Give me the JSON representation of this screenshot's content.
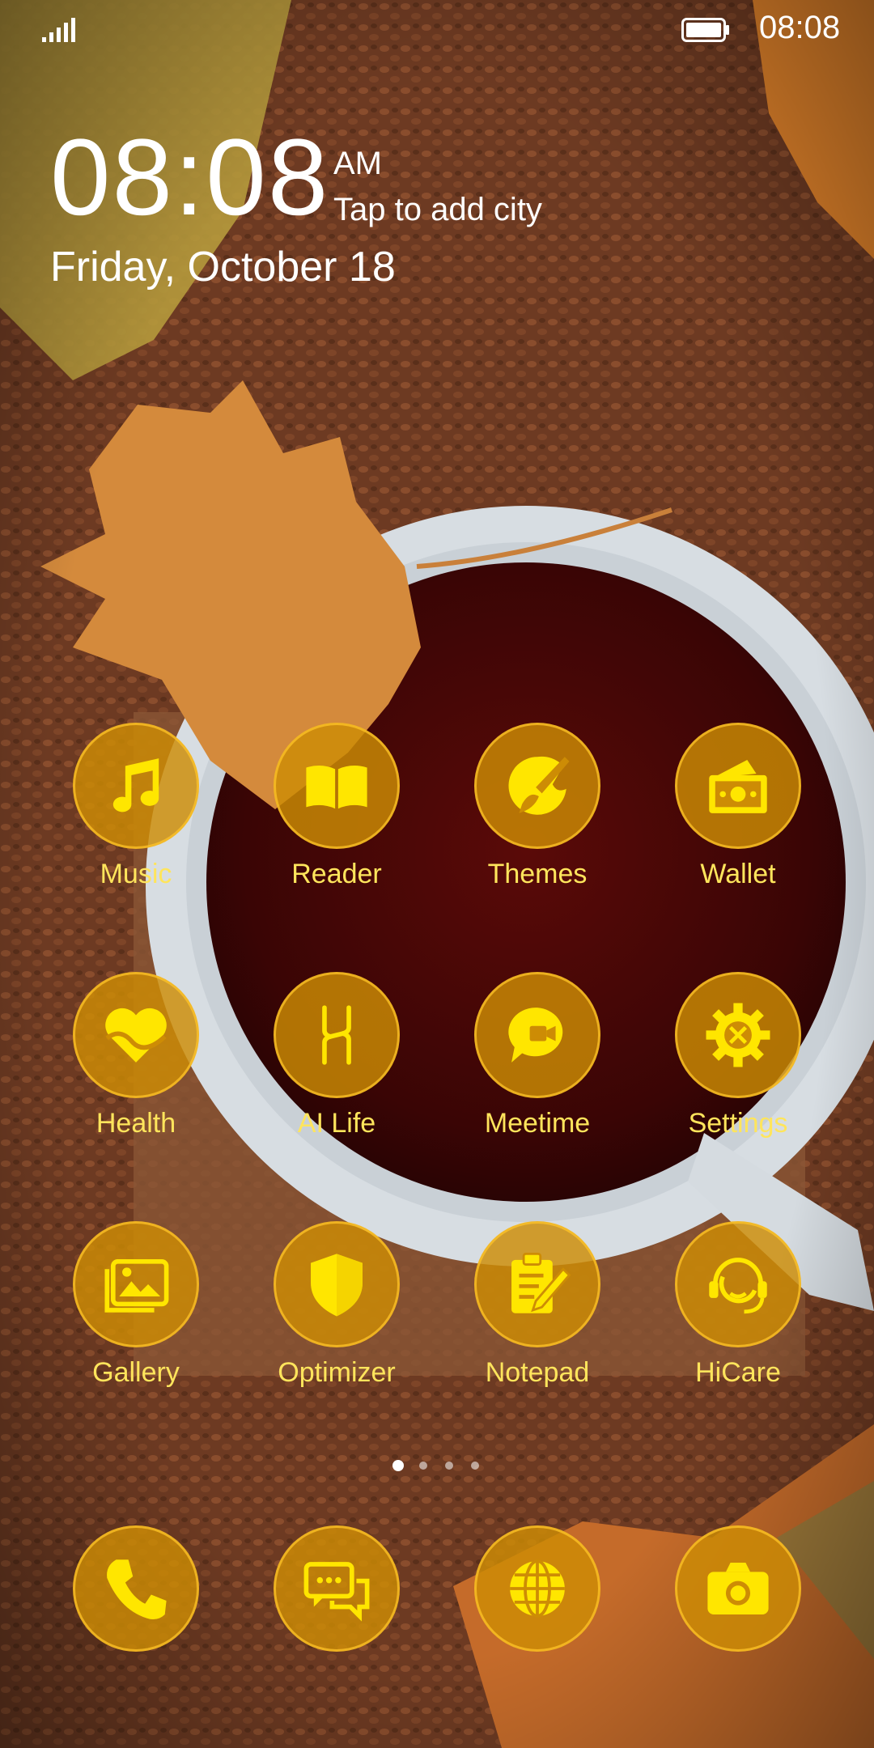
{
  "status_bar": {
    "time": "08:08"
  },
  "clock": {
    "time": "08:08",
    "ampm": "AM",
    "city_prompt": "Tap to add city",
    "date": "Friday, October 18"
  },
  "apps": [
    {
      "label": "Music",
      "icon": "music-icon"
    },
    {
      "label": "Reader",
      "icon": "book-icon"
    },
    {
      "label": "Themes",
      "icon": "paintbrush-icon"
    },
    {
      "label": "Wallet",
      "icon": "wallet-icon"
    },
    {
      "label": "Health",
      "icon": "heart-icon"
    },
    {
      "label": "AI Life",
      "icon": "ai-life-icon"
    },
    {
      "label": "Meetime",
      "icon": "video-chat-icon"
    },
    {
      "label": "Settings",
      "icon": "gear-icon"
    },
    {
      "label": "Gallery",
      "icon": "gallery-icon"
    },
    {
      "label": "Optimizer",
      "icon": "shield-icon"
    },
    {
      "label": "Notepad",
      "icon": "notepad-icon"
    },
    {
      "label": "HiCare",
      "icon": "headset-icon"
    }
  ],
  "dock": [
    {
      "icon": "phone-icon"
    },
    {
      "icon": "messages-icon"
    },
    {
      "icon": "browser-globe-icon"
    },
    {
      "icon": "camera-icon"
    }
  ],
  "pager": {
    "pages": 4,
    "current": 1
  },
  "colors": {
    "icon_fill": "#ffe600",
    "icon_bg": "#cd8c05",
    "label": "#ffe55c"
  }
}
